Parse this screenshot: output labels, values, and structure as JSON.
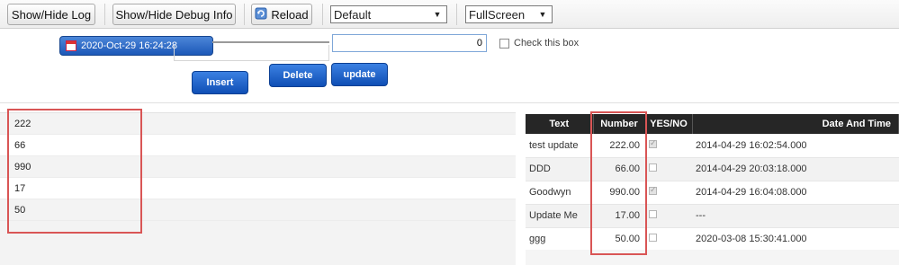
{
  "toolbar": {
    "show_hide_log": "Show/Hide Log",
    "show_hide_debug": "Show/Hide Debug Info",
    "reload": "Reload",
    "select_theme": "Default",
    "select_mode": "FullScreen"
  },
  "form": {
    "date_value": "2020-Oct-29 16:24:28",
    "number_value": "0",
    "checkbox_label": "Check this box",
    "insert_label": "Insert",
    "delete_label": "Delete",
    "update_label": "update"
  },
  "left_list": {
    "items": [
      "222",
      "66",
      "990",
      "17",
      "50"
    ]
  },
  "grid": {
    "columns": [
      "Text",
      "Number",
      "YES/NO",
      "Date And Time"
    ],
    "rows": [
      {
        "text": "test update",
        "number": "222.00",
        "yes": true,
        "date": "2014-04-29 16:02:54.000"
      },
      {
        "text": "DDD",
        "number": "66.00",
        "yes": false,
        "date": "2014-04-29 20:03:18.000"
      },
      {
        "text": "Goodwyn",
        "number": "990.00",
        "yes": true,
        "date": "2014-04-29 16:04:08.000"
      },
      {
        "text": "Update Me",
        "number": "17.00",
        "yes": false,
        "date": "---"
      },
      {
        "text": "ggg",
        "number": "50.00",
        "yes": false,
        "date": "2020-03-08 15:30:41.000"
      }
    ]
  },
  "colors": {
    "accent_blue": "#1c58b8",
    "highlight_red": "#d95555",
    "header_dark": "#262626"
  }
}
